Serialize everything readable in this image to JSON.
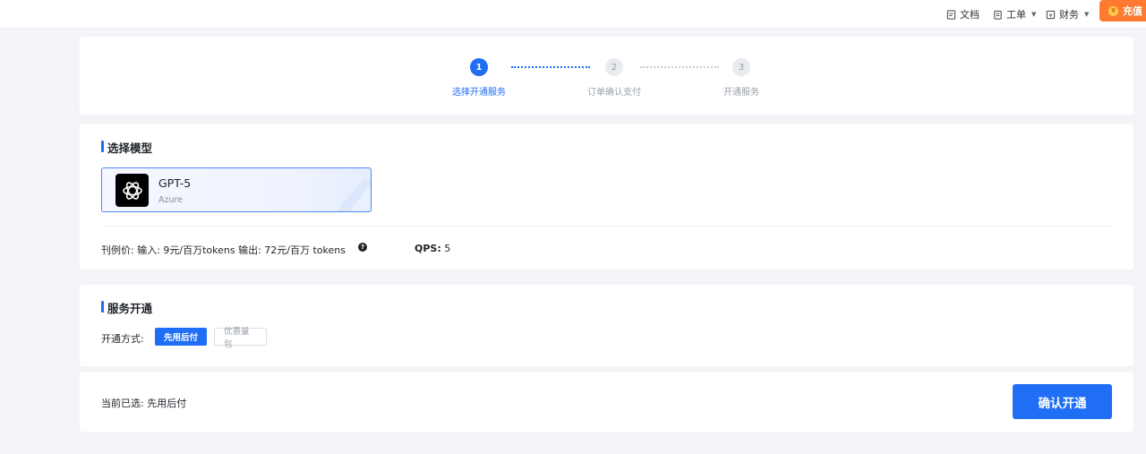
{
  "topbar": {
    "docs_label": "文档",
    "ticket_label": "工单",
    "finance_label": "财务",
    "recharge_label": "充值"
  },
  "steps": [
    {
      "num": "1",
      "label": "选择开通服务"
    },
    {
      "num": "2",
      "label": "订单确认支付"
    },
    {
      "num": "3",
      "label": "开通服务"
    }
  ],
  "model_section": {
    "title": "选择模型",
    "model": {
      "name": "GPT-5",
      "provider": "Azure",
      "icon": "openai-logo-icon"
    },
    "price_text": "刊例价:  输入:  9元/百万tokens  输出:  72元/百万 tokens",
    "qps_label": "QPS:",
    "qps_value": "5"
  },
  "service_section": {
    "title": "服务开通",
    "mode_label": "开通方式:",
    "options": [
      "先用后付",
      "优惠量包"
    ],
    "selected": "先用后付"
  },
  "footer": {
    "current_text": "当前已选:  先用后付",
    "confirm_label": "确认开通"
  },
  "colors": {
    "accent": "#1f6ef5",
    "recharge": "#ff7a30",
    "background": "#f3f4f7"
  }
}
